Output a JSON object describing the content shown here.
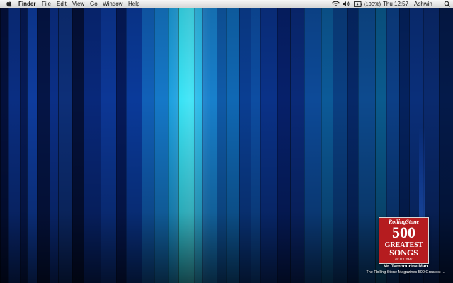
{
  "menubar": {
    "menus": [
      "Finder",
      "File",
      "Edit",
      "View",
      "Go",
      "Window",
      "Help"
    ],
    "battery_label": "(100%)",
    "clock": "Thu 12:57",
    "user": "Ashwin"
  },
  "now_playing": {
    "cover_brand": "RollingStone",
    "cover_number": "500",
    "cover_line1": "GREATEST",
    "cover_line2": "SONGS",
    "cover_tagline": "OF ALL TIME",
    "track": "Mr. Tambourine Man",
    "album": "The Rolling Stone Magazines 500 Greatest ..."
  },
  "colors": {
    "wallpaper_base": "#020a24",
    "wallpaper_highlight": "#22e0f5",
    "cover_red": "#b51c1f"
  },
  "icons": [
    "apple-icon",
    "wifi-icon",
    "volume-icon",
    "battery-icon"
  ]
}
